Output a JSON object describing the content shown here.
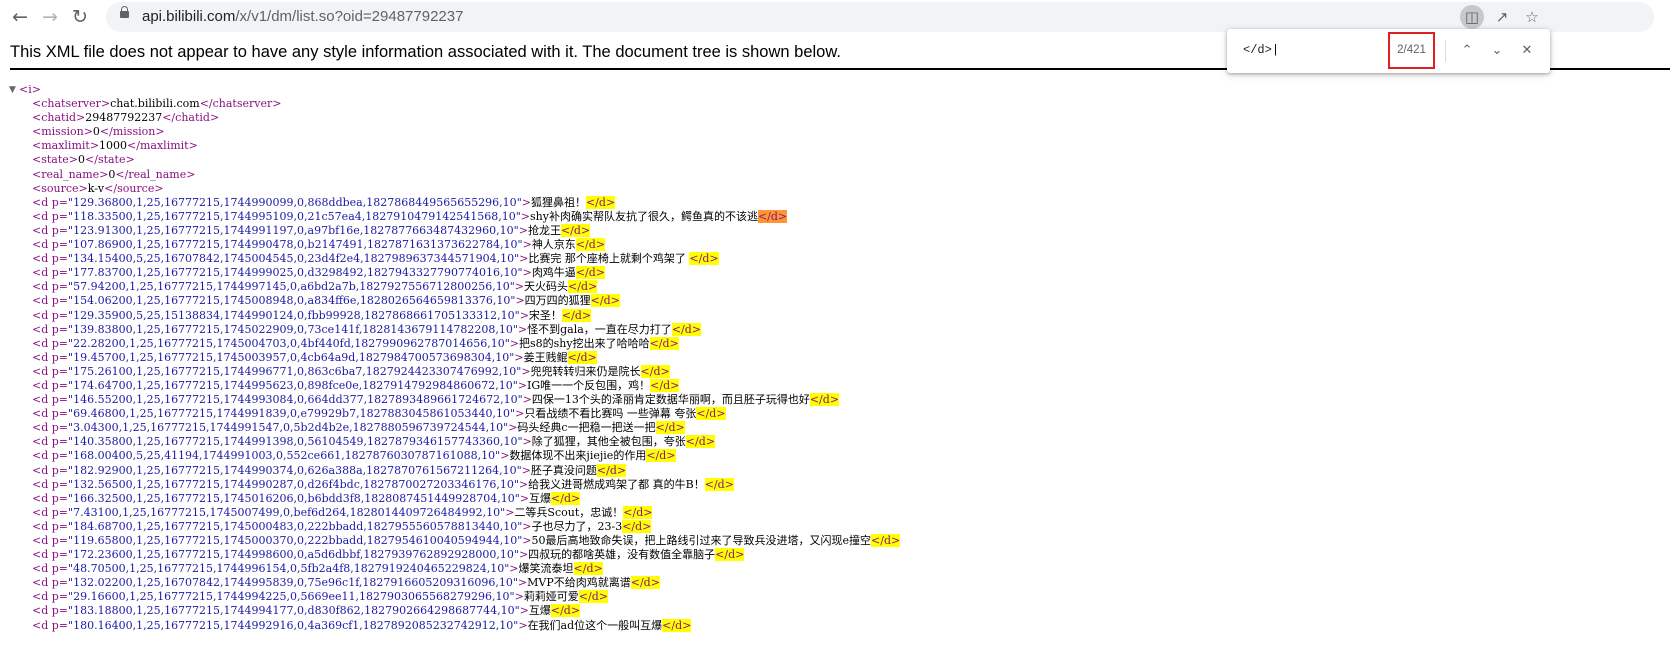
{
  "browser": {
    "url_host": "api.bilibili.com",
    "url_path": "/x/v1/dm/list.so?oid=29487792237"
  },
  "xml_info": "This XML file does not appear to have any style information associated with it. The document tree is shown below.",
  "findbar": {
    "query": "</d>",
    "count": "2/421"
  },
  "xml": {
    "root_tag": "i",
    "meta": [
      {
        "tag": "chatserver",
        "value": "chat.bilibili.com"
      },
      {
        "tag": "chatid",
        "value": "29487792237"
      },
      {
        "tag": "mission",
        "value": "0"
      },
      {
        "tag": "maxlimit",
        "value": "1000"
      },
      {
        "tag": "state",
        "value": "0"
      },
      {
        "tag": "real_name",
        "value": "0"
      },
      {
        "tag": "source",
        "value": "k-v"
      }
    ],
    "danmaku": [
      {
        "p": "129.36800,1,25,16777215,1744990099,0,868ddbea,1827868449565655296,10",
        "text": "狐狸鼻祖！"
      },
      {
        "p": "118.33500,1,25,16777215,1744995109,0,21c57ea4,1827910479142541568,10",
        "text": "shy补肉确实帮队友抗了很久，鳄鱼真的不该逃"
      },
      {
        "p": "123.91300,1,25,16777215,1744991197,0,a97bf16e,1827877663487432960,10",
        "text": "抢龙王"
      },
      {
        "p": "107.86900,1,25,16777215,1744990478,0,b2147491,1827871631373622784,10",
        "text": "神人京东"
      },
      {
        "p": "134.15400,5,25,16707842,1745004545,0,23d4f2e4,1827989637344571904,10",
        "text": "比赛完 那个座椅上就剩个鸡架了 "
      },
      {
        "p": "177.83700,1,25,16777215,1744999025,0,d3298492,1827943327790774016,10",
        "text": "肉鸡牛逼"
      },
      {
        "p": "57.94200,1,25,16777215,1744997145,0,a6bd2a7b,1827927556712800256,10",
        "text": "天火码头"
      },
      {
        "p": "154.06200,1,25,16777215,1745008948,0,a834ff6e,1828026564659813376,10",
        "text": "四万四的狐狸"
      },
      {
        "p": "129.35900,5,25,15138834,1744990124,0,fbb99928,1827868661705133312,10",
        "text": "宋圣！"
      },
      {
        "p": "139.83800,1,25,16777215,1745022909,0,73ce141f,1828143679114782208,10",
        "text": "怪不到gala，一直在尽力打了"
      },
      {
        "p": "22.28200,1,25,16777215,1745004703,0,4bf440fd,1827990962787014656,10",
        "text": "把s8的shy挖出来了哈哈哈"
      },
      {
        "p": "19.45700,1,25,16777215,1745003957,0,4cb64a9d,1827984700573698304,10",
        "text": "姜王贱鲲"
      },
      {
        "p": "175.26100,1,25,16777215,1744996771,0,863c6ba7,1827924423307476992,10",
        "text": "兜兜转转归来仍是院长"
      },
      {
        "p": "174.64700,1,25,16777215,1744995623,0,898fce0e,1827914792984860672,10",
        "text": "IG唯一一个反包围，鸡！"
      },
      {
        "p": "146.55200,1,25,16777215,1744993084,0,664dd377,1827893489661724672,10",
        "text": "四保一13个头的泽丽肯定数据华丽啊，而且胚子玩得也好"
      },
      {
        "p": "69.46800,1,25,16777215,1744991839,0,e79929b7,1827883045861053440,10",
        "text": "只看战绩不看比赛吗 一些弹幕 夸张"
      },
      {
        "p": "3.04300,1,25,16777215,1744991547,0,5b2d4b2e,1827880596739724544,10",
        "text": "码头经典c一把稳一把送一把"
      },
      {
        "p": "140.35800,1,25,16777215,1744991398,0,56104549,1827879346157743360,10",
        "text": "除了狐狸，其他全被包围，夸张"
      },
      {
        "p": "168.00400,5,25,41194,1744991003,0,552ce661,1827876030787161088,10",
        "text": "数据体现不出来jiejie的作用"
      },
      {
        "p": "182.92900,1,25,16777215,1744990374,0,626a388a,1827870761567211264,10",
        "text": "胚子真没问题"
      },
      {
        "p": "132.56500,1,25,16777215,1744990287,0,d26f4bdc,1827870027203346176,10",
        "text": "给我义进哥燃成鸡架了都 真的牛B！"
      },
      {
        "p": "166.32500,1,25,16777215,1745016206,0,b6bdd3f8,1828087451449928704,10",
        "text": "互爆"
      },
      {
        "p": "7.43100,1,25,16777215,1745007499,0,bef6d264,1828014409726484992,10",
        "text": "二等兵Scout，忠诚！"
      },
      {
        "p": "184.68700,1,25,16777215,1745000483,0,222bbadd,1827955560578813440,10",
        "text": "子也尽力了，23-3"
      },
      {
        "p": "119.65800,1,25,16777215,1745000370,0,222bbadd,1827954610040594944,10",
        "text": "50最后高地致命失误，把上路线引过来了导致兵没进塔，又闪现e撞空"
      },
      {
        "p": "172.23600,1,25,16777215,1744998600,0,a5d6dbbf,1827939762892928000,10",
        "text": "四叔玩的都啥英雄，没有数值全靠脑子"
      },
      {
        "p": "48.70500,1,25,16777215,1744996154,0,5fb2a4f8,1827919240465229824,10",
        "text": "爆笑流泰坦"
      },
      {
        "p": "132.02200,1,25,16707842,1744995839,0,75e96c1f,1827916605209316096,10",
        "text": "MVP不给肉鸡就离谱"
      },
      {
        "p": "29.16600,1,25,16777215,1744994225,0,5669ee11,1827903065568279296,10",
        "text": "莉莉娅可爱"
      },
      {
        "p": "183.18800,1,25,16777215,1744994177,0,d830f862,1827902664298687744,10",
        "text": "互爆"
      },
      {
        "p": "180.16400,1,25,16777215,1744992916,0,4a369cf1,1827892085232742912,10",
        "text": "在我们ad位这个一般叫互爆"
      }
    ]
  }
}
